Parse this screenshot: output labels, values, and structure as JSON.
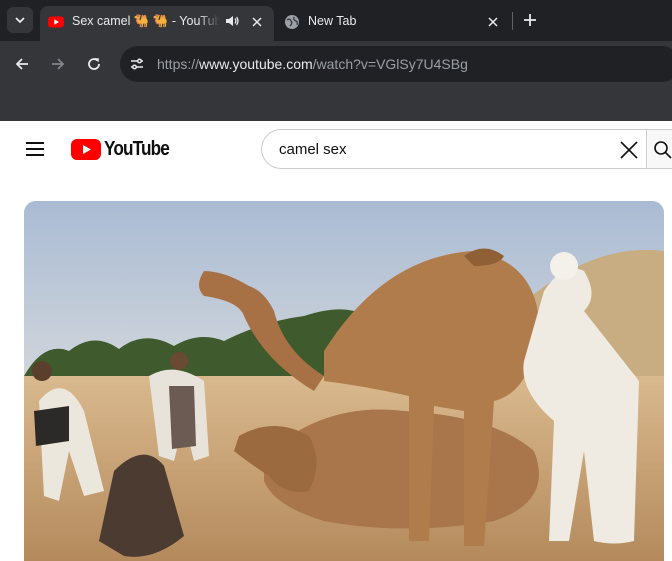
{
  "browser": {
    "tabs": [
      {
        "title": "Sex camel 🐫 🐫 - YouTube",
        "active": true,
        "favicon": "youtube-favicon",
        "audio": "speaker-icon"
      },
      {
        "title": "New Tab",
        "active": false,
        "favicon": "globe-favicon"
      }
    ],
    "url": {
      "scheme": "https://",
      "host": "www.youtube.com",
      "path": "/watch?v=VGlSy7U4SBg"
    }
  },
  "youtube": {
    "logo_text": "YouTube",
    "search": {
      "value": "camel sex"
    }
  },
  "video": {
    "scene": "Men with camels in a sandy desert"
  },
  "colors": {
    "chrome_dark": "#202124",
    "chrome_toolbar": "#35363a",
    "youtube_red": "#ff0000"
  }
}
